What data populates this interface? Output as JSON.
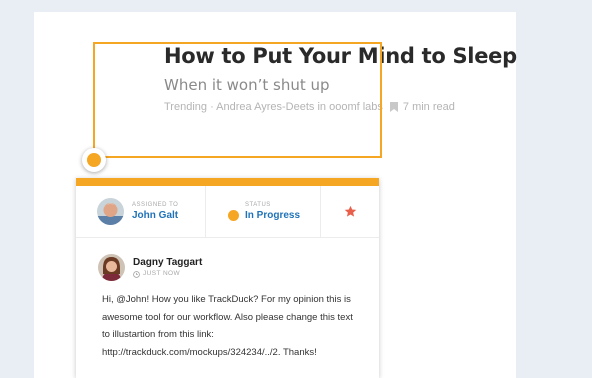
{
  "article": {
    "title": "How to Put Your Mind to Sleep",
    "subtitle": "When it won’t shut up",
    "meta_prefix": "Trending · Andrea Ayres-Deets in ooomf labs",
    "read_time": "7 min read"
  },
  "card": {
    "assigned_label": "ASSIGNED TO",
    "assignee": "John Galt",
    "status_label": "STATUS",
    "status": "In Progress",
    "status_color": "#f5a623",
    "star_icon": "star-icon",
    "star_color": "#e8604c"
  },
  "comment": {
    "author": "Dagny Taggart",
    "time": "JUST NOW",
    "text": "Hi, @John! How you like TrackDuck? For my opinion this is awesome tool for our workflow. Also please change this text to illustartion from this link: http://trackduck.com/mockups/324234/../2. Thanks!"
  },
  "colors": {
    "accent": "#f5a623",
    "link": "#1f72b8",
    "background": "#e9eef4"
  }
}
